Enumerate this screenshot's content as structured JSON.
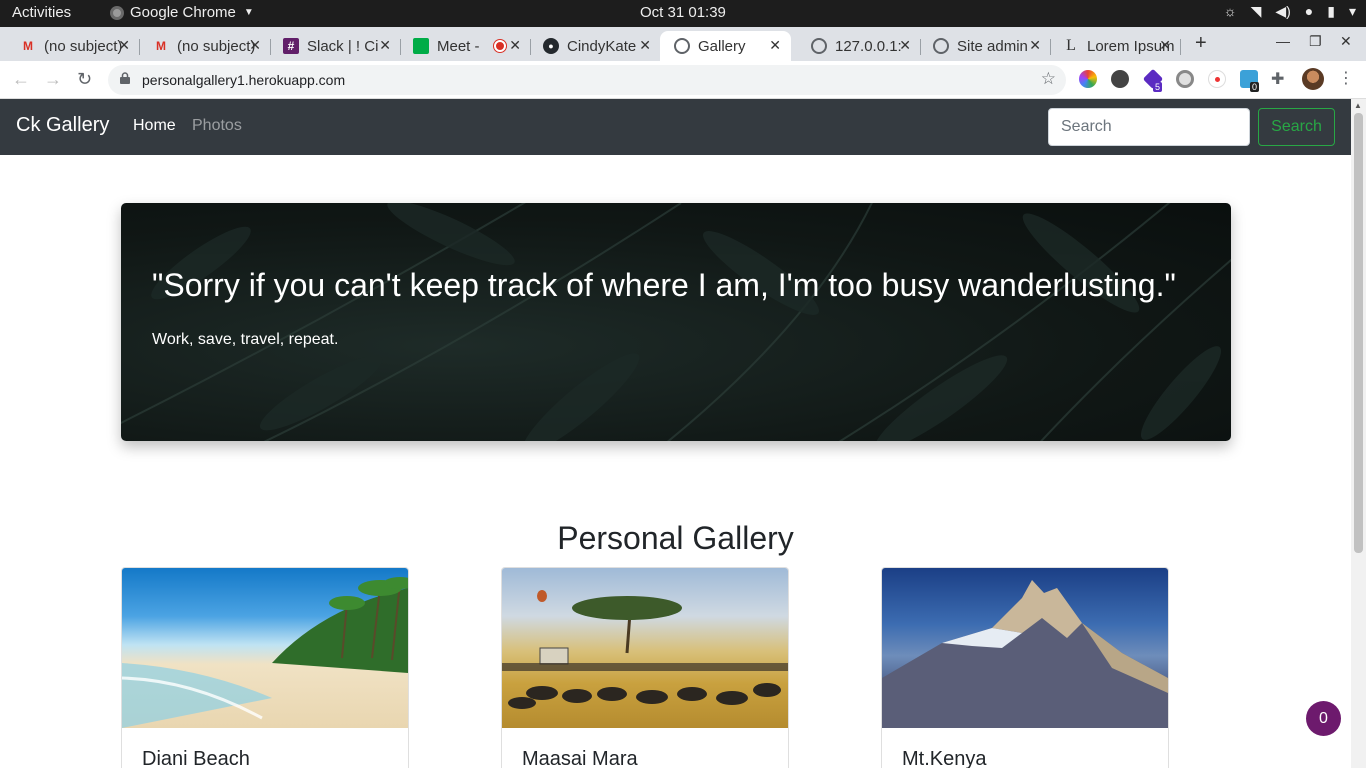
{
  "system": {
    "activities": "Activities",
    "app_name": "Google Chrome",
    "clock": "Oct 31  01:39"
  },
  "tabs": [
    {
      "title": "(no subject)",
      "icon": "gmail-icon"
    },
    {
      "title": "(no subject)",
      "icon": "gmail-icon"
    },
    {
      "title": "Slack | ! Ci",
      "icon": "slack-icon"
    },
    {
      "title": "Meet -",
      "icon": "meet-icon"
    },
    {
      "title": "CindyKate",
      "icon": "github-icon"
    },
    {
      "title": "Gallery",
      "icon": "globe-icon",
      "active": true
    },
    {
      "title": "127.0.0.1:",
      "icon": "globe-icon"
    },
    {
      "title": "Site admin",
      "icon": "globe-icon"
    },
    {
      "title": "Lorem Ipsum",
      "icon": "lorem-icon"
    }
  ],
  "browser": {
    "url": "personalgallery1.herokuapp.com",
    "ext_badge_1": "5",
    "ext_badge_2": "0"
  },
  "navbar": {
    "brand": "Ck Gallery",
    "home": "Home",
    "photos": "Photos",
    "search_placeholder": "Search",
    "search_button": "Search"
  },
  "hero": {
    "quote": "\"Sorry if you can't keep track of where I am, I'm too busy wanderlusting.\"",
    "tagline": "Work, save, travel, repeat."
  },
  "gallery": {
    "title": "Personal Gallery",
    "cards": [
      {
        "title": "Diani Beach"
      },
      {
        "title": "Maasai Mara"
      },
      {
        "title": "Mt.Kenya"
      }
    ]
  },
  "chat_badge": "0",
  "colors": {
    "navbar_bg": "#343a40",
    "search_green": "#28a745",
    "chat_purple": "#6d1a6d"
  }
}
